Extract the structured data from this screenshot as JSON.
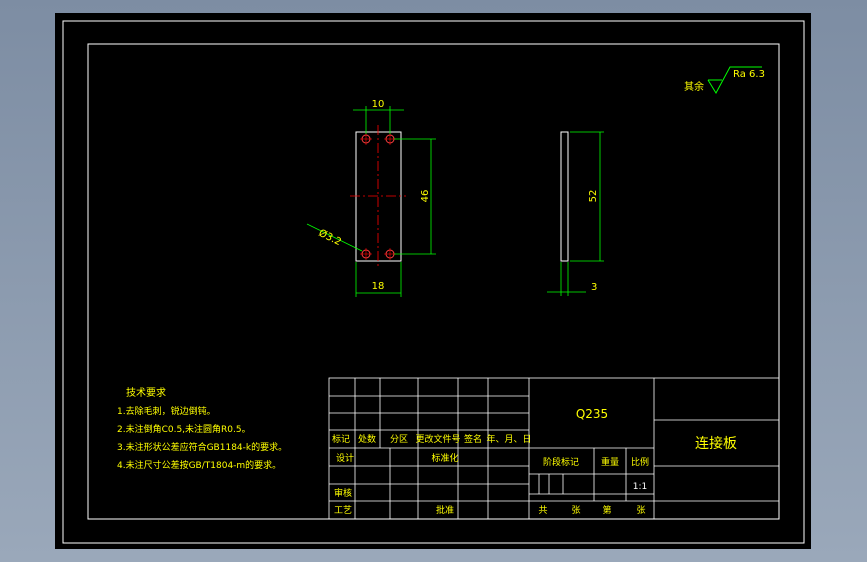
{
  "colors": {
    "background": "#000000",
    "frame": "#ffffff",
    "dimension": "#00ff00",
    "centerline": "#ff0000",
    "hole": "#ff3030",
    "text_yellow": "#ffff00",
    "text_green": "#00ff00",
    "text_white": "#ffffff"
  },
  "surface_roughness": {
    "prefix": "其余",
    "value": "Ra 6.3"
  },
  "dimensions": {
    "top_width": "10",
    "bottom_width": "18",
    "height": "46",
    "hole": "Ø3.2",
    "side_height": "52",
    "thickness": "3"
  },
  "notes": {
    "title": "技术要求",
    "items": [
      "1.去除毛刺，锐边倒钝。",
      "2.未注倒角C0.5,未注圆角R0.5。",
      "3.未注形状公差应符合GB1184-k的要求。",
      "4.未注尺寸公差按GB/T1804-m的要求。"
    ]
  },
  "title_block": {
    "material": "Q235",
    "part_name": "连接板",
    "revision_headers": [
      "标记",
      "处数",
      "分区",
      "更改文件号",
      "签名",
      "年、月、日"
    ],
    "design": "设计",
    "standardize": "标准化",
    "review": "审核",
    "process": "工艺",
    "approve": "批准",
    "stage_mark": "阶段标记",
    "weight": "重量",
    "scale_label": "比例",
    "scale": "1:1",
    "total": "共",
    "sheets": "张",
    "no": "第",
    "sheet": "张"
  }
}
